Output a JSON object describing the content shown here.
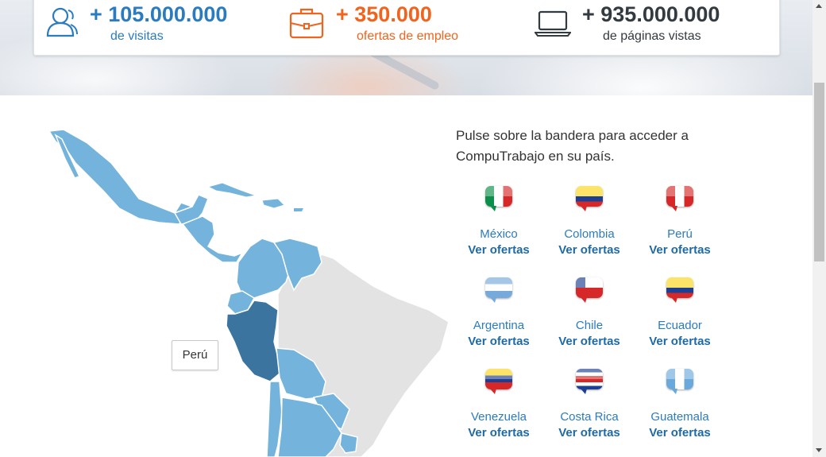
{
  "stats": [
    {
      "number": "+ 105.000.000",
      "label": "de visitas",
      "icon": "users-icon",
      "color": "#2b7bbf"
    },
    {
      "number": "+ 350.000",
      "label": "ofertas de empleo",
      "icon": "briefcase-icon",
      "color": "#f0641e"
    },
    {
      "number": "+ 935.000.000",
      "label": "de páginas vistas",
      "icon": "laptop-icon",
      "color": "#333a40"
    }
  ],
  "intro": "Pulse sobre la bandera para acceder a CompuTrabajo en su país.",
  "map_tooltip": "Perú",
  "link_label": "Ver ofertas",
  "countries": [
    {
      "name": "México"
    },
    {
      "name": "Colombia"
    },
    {
      "name": "Perú"
    },
    {
      "name": "Argentina"
    },
    {
      "name": "Chile"
    },
    {
      "name": "Ecuador"
    },
    {
      "name": "Venezuela"
    },
    {
      "name": "Costa Rica"
    },
    {
      "name": "Guatemala"
    }
  ],
  "colors": {
    "map_country": "#74b3db",
    "map_selected": "#3a749f",
    "map_other": "#e3e3e3",
    "link": "#1e6aa8"
  }
}
